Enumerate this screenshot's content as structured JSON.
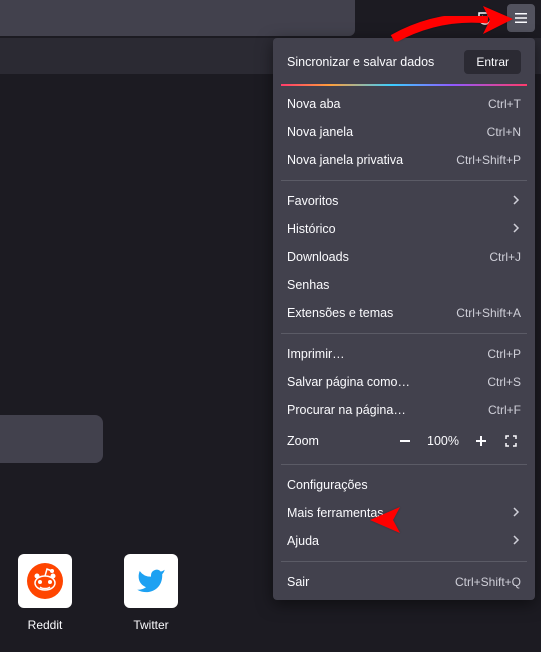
{
  "toolbar": {
    "pocket_icon": "pocket",
    "menu_icon": "menu"
  },
  "menu": {
    "sync_label": "Sincronizar e salvar dados",
    "enter_label": "Entrar",
    "items_group1": [
      {
        "label": "Nova aba",
        "shortcut": "Ctrl+T"
      },
      {
        "label": "Nova janela",
        "shortcut": "Ctrl+N"
      },
      {
        "label": "Nova janela privativa",
        "shortcut": "Ctrl+Shift+P"
      }
    ],
    "items_group2": [
      {
        "label": "Favoritos",
        "chevron": true
      },
      {
        "label": "Histórico",
        "chevron": true
      },
      {
        "label": "Downloads",
        "shortcut": "Ctrl+J"
      },
      {
        "label": "Senhas"
      },
      {
        "label": "Extensões e temas",
        "shortcut": "Ctrl+Shift+A"
      }
    ],
    "items_group3": [
      {
        "label": "Imprimir…",
        "shortcut": "Ctrl+P"
      },
      {
        "label": "Salvar página como…",
        "shortcut": "Ctrl+S"
      },
      {
        "label": "Procurar na página…",
        "shortcut": "Ctrl+F"
      }
    ],
    "zoom": {
      "label": "Zoom",
      "value": "100%"
    },
    "items_group4": [
      {
        "label": "Configurações"
      },
      {
        "label": "Mais ferramentas",
        "chevron": true
      },
      {
        "label": "Ajuda",
        "chevron": true
      }
    ],
    "items_group5": [
      {
        "label": "Sair",
        "shortcut": "Ctrl+Shift+Q"
      }
    ]
  },
  "shortcuts": [
    {
      "label": "Reddit",
      "color": "#ff4500"
    },
    {
      "label": "Twitter",
      "color": "#1da1f2"
    }
  ]
}
